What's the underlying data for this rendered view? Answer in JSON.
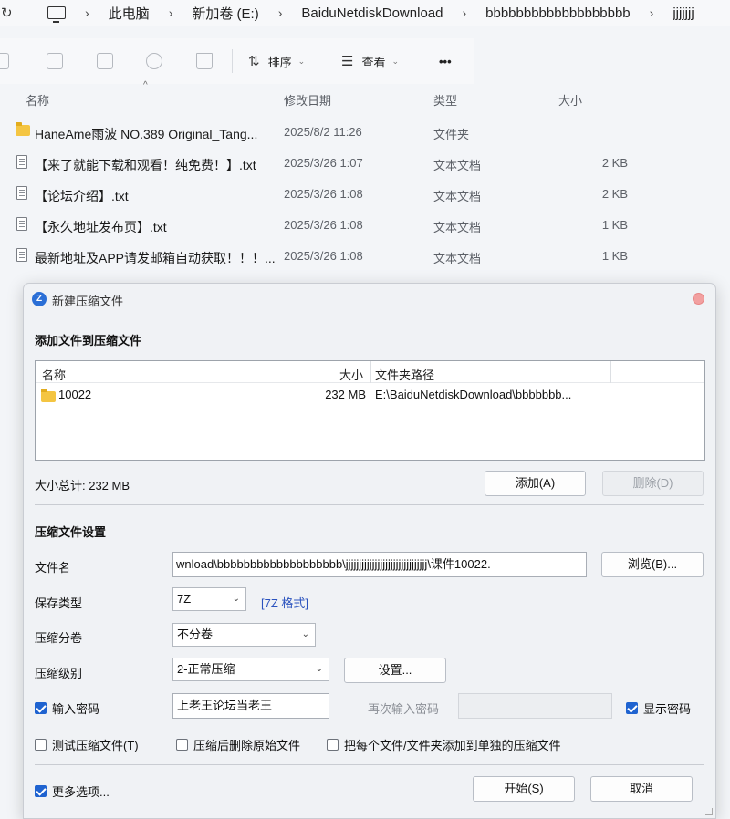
{
  "explorer": {
    "breadcrumb": [
      "此电脑",
      "新加卷 (E:)",
      "BaiduNetdiskDownload",
      "bbbbbbbbbbbbbbbbbbb",
      "jjjjjjj"
    ],
    "toolbar": {
      "sort_label": "排序",
      "view_label": "查看",
      "more_label": "•••"
    },
    "columns": {
      "name": "名称",
      "date": "修改日期",
      "type": "类型",
      "size": "大小"
    },
    "files": [
      {
        "name": "HaneAme雨波 NO.389 Original_Tang...",
        "date": "2025/8/2 11:26",
        "type": "文件夹",
        "size": "",
        "icon": "folder-icon"
      },
      {
        "name": "【来了就能下载和观看！纯免费！】.txt",
        "date": "2025/3/26 1:07",
        "type": "文本文档",
        "size": "2 KB",
        "icon": "text-file-icon"
      },
      {
        "name": "【论坛介绍】.txt",
        "date": "2025/3/26 1:08",
        "type": "文本文档",
        "size": "2 KB",
        "icon": "text-file-icon"
      },
      {
        "name": "【永久地址发布页】.txt",
        "date": "2025/3/26 1:08",
        "type": "文本文档",
        "size": "1 KB",
        "icon": "text-file-icon"
      },
      {
        "name": "最新地址及APP请发邮箱自动获取！！！...",
        "date": "2025/3/26 1:08",
        "type": "文本文档",
        "size": "1 KB",
        "icon": "text-file-icon"
      }
    ]
  },
  "dialog": {
    "title": "新建压缩文件",
    "add_section_title": "添加文件到压缩文件",
    "list_columns": {
      "name": "名称",
      "size": "大小",
      "path": "文件夹路径"
    },
    "list_items": [
      {
        "name": "10022",
        "size": "232 MB",
        "path": "E:\\BaiduNetdiskDownload\\bbbbbbb..."
      }
    ],
    "total_size": "大小总计: 232 MB",
    "add_button": "添加(A)",
    "delete_button": "删除(D)",
    "settings_section_title": "压缩文件设置",
    "filename_label": "文件名",
    "filename_value": "wnload\\bbbbbbbbbbbbbbbbbbb\\jjjjjjjjjjjjjjjjjjjjjjjjjjjjjjj\\课件10022.",
    "browse_button": "浏览(B)...",
    "save_type_label": "保存类型",
    "save_type_value": "7Z",
    "format_link": "[7Z 格式]",
    "split_label": "压缩分卷",
    "split_value": "不分卷",
    "level_label": "压缩级别",
    "level_value": "2-正常压缩",
    "settings_button": "设置...",
    "password_check_label": "输入密码",
    "password_checked": true,
    "password_value": "上老王论坛当老王",
    "reenter_label": "再次输入密码",
    "show_password_label": "显示密码",
    "show_password_checked": true,
    "test_label": "测试压缩文件(T)",
    "test_checked": false,
    "delete_after_label": "压缩后删除原始文件",
    "delete_after_checked": false,
    "separate_label": "把每个文件/文件夹添加到单独的压缩文件",
    "separate_checked": false,
    "more_options_label": "更多选项...",
    "more_options_checked": true,
    "start_button": "开始(S)",
    "cancel_button": "取消"
  }
}
